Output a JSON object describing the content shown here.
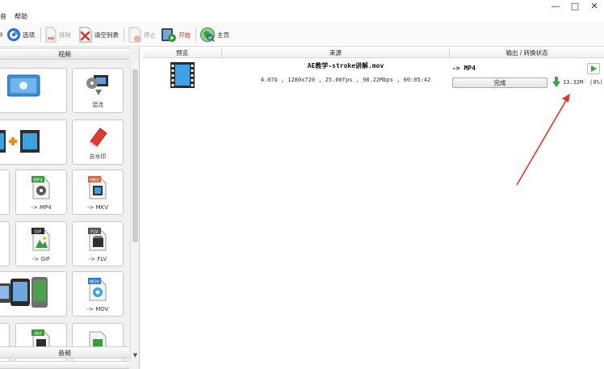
{
  "window": {
    "minimize": "—",
    "maximize": "□",
    "close": "✕"
  },
  "menu": {
    "items": [
      "音",
      "帮助"
    ]
  },
  "toolbar": {
    "options_label": "选项",
    "remove_label": "移除",
    "clear_list_label": "清空列表",
    "stop_label": "停止",
    "start_label": "开始",
    "home_label": "主页"
  },
  "leftpanel": {
    "video_header": "视频",
    "audio_header": "音频",
    "tiles": [
      {
        "label": ""
      },
      {
        "label": "混流"
      },
      {
        "label": ""
      },
      {
        "label": "去水印"
      },
      {
        "label": ""
      },
      {
        "label": "-> MP4",
        "badge": "MP4"
      },
      {
        "label": "-> MKV",
        "badge": "MKV"
      },
      {
        "label": ""
      },
      {
        "label": "-> GIF",
        "badge": "GIF"
      },
      {
        "label": "-> FLV",
        "badge": "FLV"
      },
      {
        "label": ""
      },
      {
        "label": "-> MOV",
        "badge": "MOV"
      },
      {
        "label": ""
      },
      {
        "label": "",
        "badge": "AVI"
      },
      {
        "label": ""
      }
    ]
  },
  "task_list": {
    "columns": [
      "预览",
      "来源",
      "输出 / 转换状态"
    ],
    "rows": [
      {
        "source_name": "AE教学-stroke讲解.mov",
        "source_meta": "4.07G , 1280x720 , 25.00fps , 98.22Mbps , 00:05:42",
        "output_format": "-> MP4",
        "status": "完成",
        "output_size": "13.32M",
        "percent": "(0%)"
      }
    ]
  },
  "colors": {
    "accent_red": "#d0302a",
    "arrow_green": "#3aa53a",
    "annotation_arrow": "#e0352b"
  }
}
